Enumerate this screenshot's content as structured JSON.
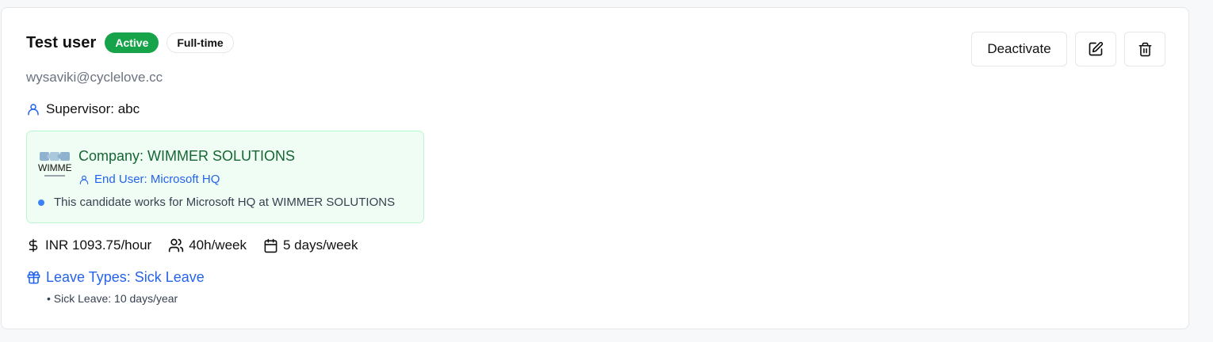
{
  "user": {
    "name": "Test user",
    "status_badge": "Active",
    "employment_badge": "Full-time",
    "email": "wysaviki@cyclelove.cc",
    "supervisor": "Supervisor: abc"
  },
  "company": {
    "name": "Company: WIMMER SOLUTIONS",
    "logo_text": "WIMMER",
    "end_user": "End User: Microsoft HQ",
    "note": "This candidate works for Microsoft HQ at WIMMER SOLUTIONS"
  },
  "stats": {
    "rate": "INR 1093.75/hour",
    "hours": "40h/week",
    "days": "5 days/week"
  },
  "leave": {
    "title": "Leave Types: Sick Leave",
    "items": [
      "• Sick Leave: 10 days/year"
    ]
  },
  "actions": {
    "deactivate_label": "Deactivate",
    "edit_icon": "edit-icon",
    "delete_icon": "trash-icon"
  },
  "colors": {
    "active_badge": "#16a34a",
    "company_bg": "#f0fdf4",
    "company_text": "#166534",
    "link_blue": "#2563eb"
  }
}
